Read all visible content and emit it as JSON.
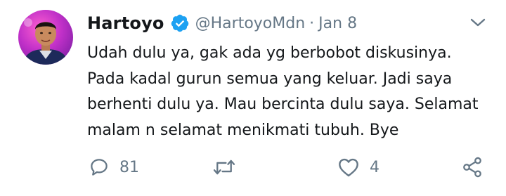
{
  "tweet": {
    "author_name": "Hartoyo",
    "handle": "@HartoyoMdn",
    "separator": "·",
    "date": "Jan 8",
    "text": "Udah dulu ya, gak ada yg berbobot diskusinya. Pada kadal gurun semua yang keluar. Jadi saya berhenti dulu ya. Mau bercinta dulu saya. Selamat malam n selamat menikmati tubuh. Bye"
  },
  "actions": {
    "reply_count": "81",
    "retweet_count": "",
    "like_count": "4"
  },
  "icons": {
    "verified": "verified-badge-icon",
    "caret": "chevron-down-icon",
    "reply": "reply-icon",
    "retweet": "retweet-icon",
    "like": "heart-icon",
    "share": "share-icon"
  },
  "colors": {
    "verified_blue": "#1da1f2",
    "secondary_text": "#657786",
    "primary_text": "#14171a"
  }
}
